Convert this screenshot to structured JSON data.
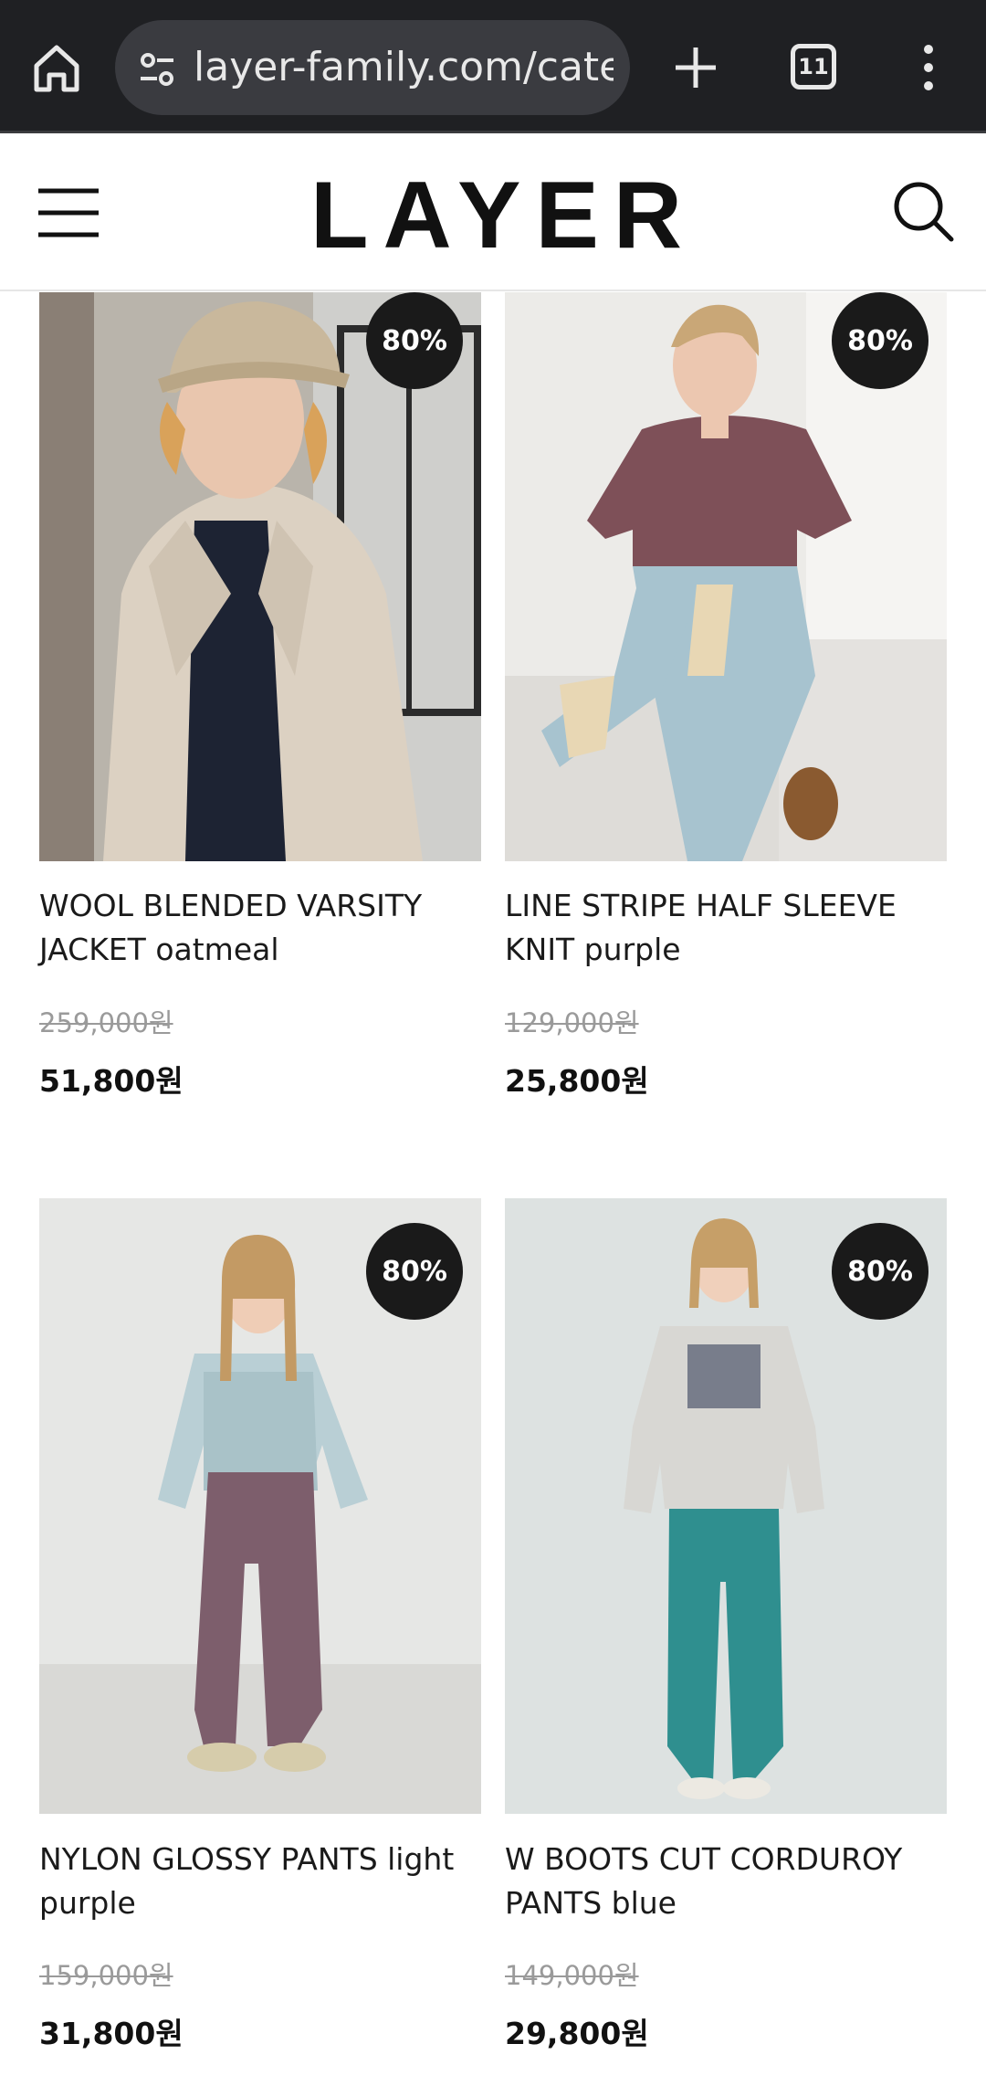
{
  "browser": {
    "url": "layer-family.com/category/",
    "tab_count": "11",
    "icons": [
      "home-icon",
      "tune-icon",
      "plus-icon",
      "tabs-icon",
      "more-vert-icon"
    ],
    "bar_color": "#1f2023"
  },
  "header": {
    "logo": "LAYER",
    "icons": [
      "menu-icon",
      "search-icon"
    ]
  },
  "products": [
    {
      "name": "WOOL BLENDED VARSITY JACKET oatmeal",
      "discount": "80%",
      "original_price": "259,000원",
      "sale_price": "51,800원"
    },
    {
      "name": "LINE STRIPE HALF SLEEVE KNIT purple",
      "discount": "80%",
      "original_price": "129,000원",
      "sale_price": "25,800원"
    },
    {
      "name": "NYLON GLOSSY PANTS light purple",
      "discount": "80%",
      "original_price": "159,000원",
      "sale_price": "31,800원"
    },
    {
      "name": "W BOOTS CUT CORDUROY PANTS blue",
      "discount": "80%",
      "original_price": "149,000원",
      "sale_price": "29,800원"
    }
  ],
  "colors": {
    "badge": "#1a1a1a",
    "original_price": "#9a9a9a",
    "accent": "#111111"
  }
}
